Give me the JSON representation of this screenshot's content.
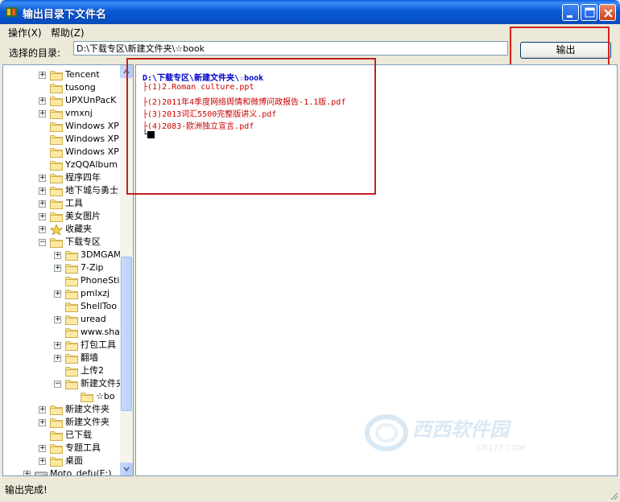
{
  "window": {
    "title": "输出目录下文件名"
  },
  "menu": [
    {
      "label": "操作(X)"
    },
    {
      "label": "帮助(Z)"
    }
  ],
  "directory": {
    "label": "选择的目录:",
    "value": "D:\\下载专区\\新建文件夹\\☆book"
  },
  "output_button": {
    "label": "输出"
  },
  "tree": {
    "items": [
      {
        "label": "Tencent",
        "expander": "+"
      },
      {
        "label": "tusong",
        "expander": ""
      },
      {
        "label": "UPXUnPacK",
        "expander": "+"
      },
      {
        "label": "vmxnj",
        "expander": "+"
      },
      {
        "label": "Windows XP",
        "expander": ""
      },
      {
        "label": "Windows XP",
        "expander": ""
      },
      {
        "label": "Windows XP",
        "expander": ""
      },
      {
        "label": "YzQQAlbum",
        "expander": ""
      },
      {
        "label": "程序四年",
        "expander": "+"
      },
      {
        "label": "地下城与勇士",
        "expander": "+"
      },
      {
        "label": "工具",
        "expander": "+"
      },
      {
        "label": "美女图片",
        "expander": "+"
      },
      {
        "label": "收藏夹",
        "expander": "+"
      },
      {
        "label": "下载专区",
        "expander": "−"
      },
      {
        "label": "3DMGAME",
        "expander": "+"
      },
      {
        "label": "7-Zip",
        "expander": "+"
      },
      {
        "label": "PhoneSti",
        "expander": ""
      },
      {
        "label": "pmlxzj",
        "expander": "+"
      },
      {
        "label": "ShellToo",
        "expander": ""
      },
      {
        "label": "uread",
        "expander": "+"
      },
      {
        "label": "www.sha",
        "expander": ""
      },
      {
        "label": "打包工具",
        "expander": "+"
      },
      {
        "label": "翻墙",
        "expander": "+"
      },
      {
        "label": "上传2",
        "expander": ""
      },
      {
        "label": "新建文件夹",
        "expander": "−"
      },
      {
        "label": "☆bo",
        "expander": ""
      },
      {
        "label": "新建文件夹",
        "expander": "+"
      },
      {
        "label": "新建文件夹",
        "expander": "+"
      },
      {
        "label": "已下载",
        "expander": ""
      },
      {
        "label": "专题工具",
        "expander": "+"
      },
      {
        "label": "桌面",
        "expander": "+"
      },
      {
        "label": "Moto_defu(E:)",
        "expander": "+"
      }
    ]
  },
  "output": {
    "root": "D:\\下载专区\\新建文件夹\\☆book",
    "files": [
      "├(1)2.Roman culture.ppt",
      "├(2)2011年4季度网络舆情和微博问政报告-1.1版.pdf",
      "├(3)2013词汇5500完整版讲义.pdf",
      "├(4)2083-欧洲独立宣言.pdf"
    ],
    "end_marker": "└"
  },
  "watermark": {
    "text": "西西软件园",
    "subtext": "CR173.COM"
  },
  "status": {
    "text": "输出完成!"
  },
  "colors": {
    "titlebar": "#0a5ad6",
    "root_text": "#0000cc",
    "file_text": "#cc0000",
    "highlight_box": "#d42020"
  }
}
